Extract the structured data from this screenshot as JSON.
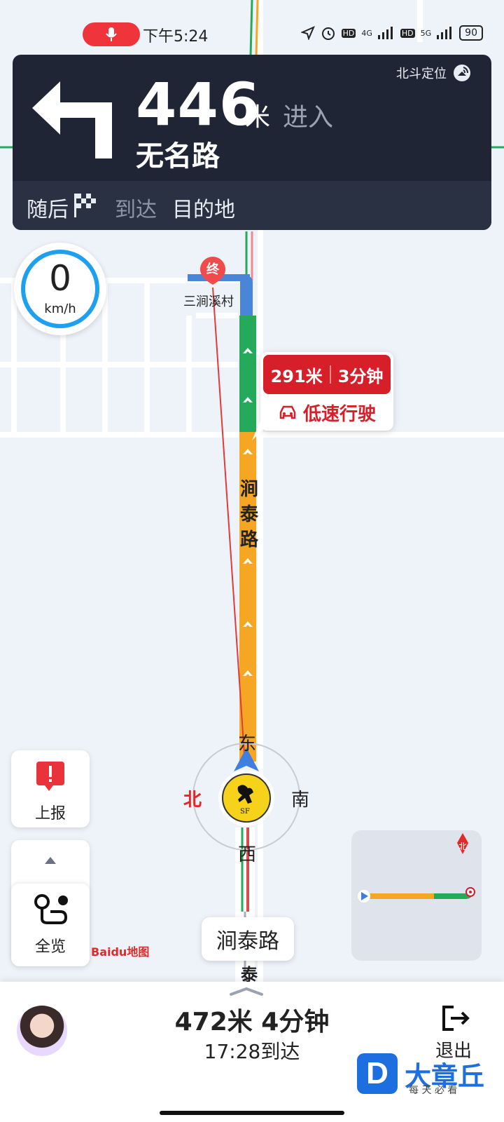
{
  "status_bar": {
    "time": "下午5:24",
    "net1": "4G",
    "net2": "5G",
    "battery": "90"
  },
  "nav_card": {
    "distance": "446",
    "unit": "米",
    "action": "进入",
    "road": "无名路",
    "positioning": "北斗定位",
    "next_prefix": "随后",
    "next_action": "到达",
    "next_target": "目的地"
  },
  "speed": {
    "value": "0",
    "unit": "km/h"
  },
  "map": {
    "dest_marker": "终",
    "dest_name": "三涧溪村",
    "street_name_vertical": [
      "涧",
      "泰",
      "路"
    ],
    "street_bottom": "泰",
    "compass": {
      "east": "东",
      "north": "北",
      "south": "南",
      "west": "西"
    },
    "logo_text": "Baidu地图"
  },
  "traffic_bubble": {
    "distance": "291米",
    "time": "3分钟",
    "status": "低速行驶"
  },
  "controls": {
    "report_label": "上报",
    "overview_label": "全览",
    "minimap_north": "北",
    "current_road": "涧泰路"
  },
  "bottom_panel": {
    "summary": "472米 4分钟",
    "eta": "17:28到达",
    "exit_label": "退出"
  },
  "watermark": {
    "brand": "大章丘",
    "tagline": "每 天 必 看"
  },
  "colors": {
    "nav_bg": "#1f2534",
    "route_green": "#25a95a",
    "route_orange": "#f5a623",
    "alert_red": "#d61f29",
    "accent_blue": "#1ea0f0"
  }
}
